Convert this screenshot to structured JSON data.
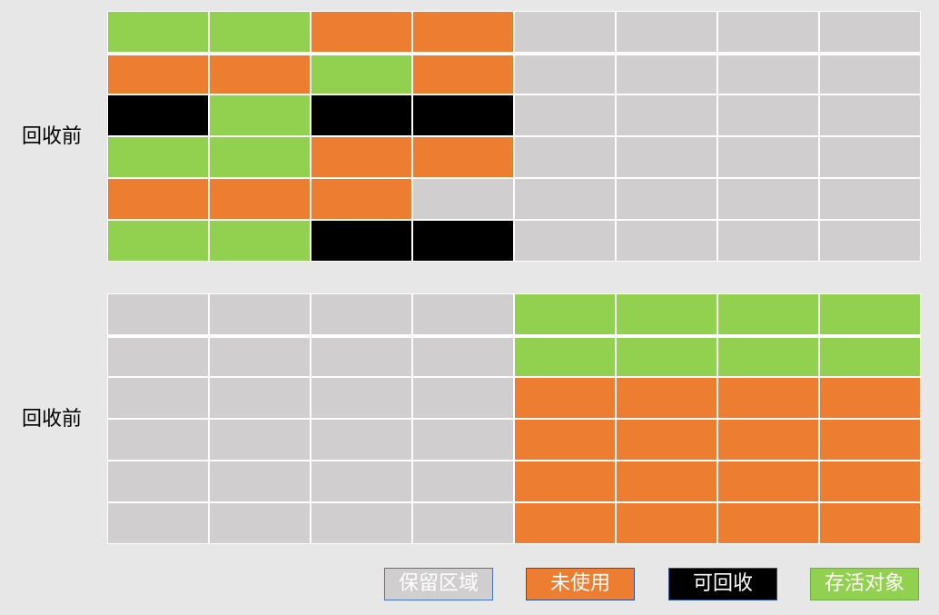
{
  "colors": {
    "reserved": "#d0cecf",
    "unused": "#ed7d31",
    "reclaimable": "#000000",
    "live": "#92d050"
  },
  "top": {
    "label": "回收前",
    "rows": [
      [
        "live",
        "live",
        "unused",
        "unused",
        "reserved",
        "reserved",
        "reserved",
        "reserved"
      ],
      [
        "unused",
        "unused",
        "live",
        "unused",
        "reserved",
        "reserved",
        "reserved",
        "reserved"
      ],
      [
        "reclaimable",
        "live",
        "reclaimable",
        "reclaimable",
        "reserved",
        "reserved",
        "reserved",
        "reserved"
      ],
      [
        "live",
        "live",
        "unused",
        "unused",
        "reserved",
        "reserved",
        "reserved",
        "reserved"
      ],
      [
        "unused",
        "unused",
        "unused",
        "reserved",
        "reserved",
        "reserved",
        "reserved",
        "reserved"
      ],
      [
        "live",
        "live",
        "reclaimable",
        "reclaimable",
        "reserved",
        "reserved",
        "reserved",
        "reserved"
      ]
    ]
  },
  "bottom": {
    "label": "回收前",
    "rows": [
      [
        "reserved",
        "reserved",
        "reserved",
        "reserved",
        "live",
        "live",
        "live",
        "live"
      ],
      [
        "reserved",
        "reserved",
        "reserved",
        "reserved",
        "live",
        "live",
        "live",
        "live"
      ],
      [
        "reserved",
        "reserved",
        "reserved",
        "reserved",
        "unused",
        "unused",
        "unused",
        "unused"
      ],
      [
        "reserved",
        "reserved",
        "reserved",
        "reserved",
        "unused",
        "unused",
        "unused",
        "unused"
      ],
      [
        "reserved",
        "reserved",
        "reserved",
        "reserved",
        "unused",
        "unused",
        "unused",
        "unused"
      ],
      [
        "reserved",
        "reserved",
        "reserved",
        "reserved",
        "unused",
        "unused",
        "unused",
        "unused"
      ]
    ]
  },
  "legend": {
    "reserved": {
      "label": "保留区域",
      "text_color": "#ffffff",
      "border": "#4472c4"
    },
    "unused": {
      "label": "未使用",
      "text_color": "#ffffff",
      "border": "#2f5597"
    },
    "reclaimable": {
      "label": "可回收",
      "text_color": "#ffffff",
      "border": "#2f5597"
    },
    "live": {
      "label": "存活对象",
      "text_color": "#ffffff",
      "border": "#70ad47"
    }
  }
}
